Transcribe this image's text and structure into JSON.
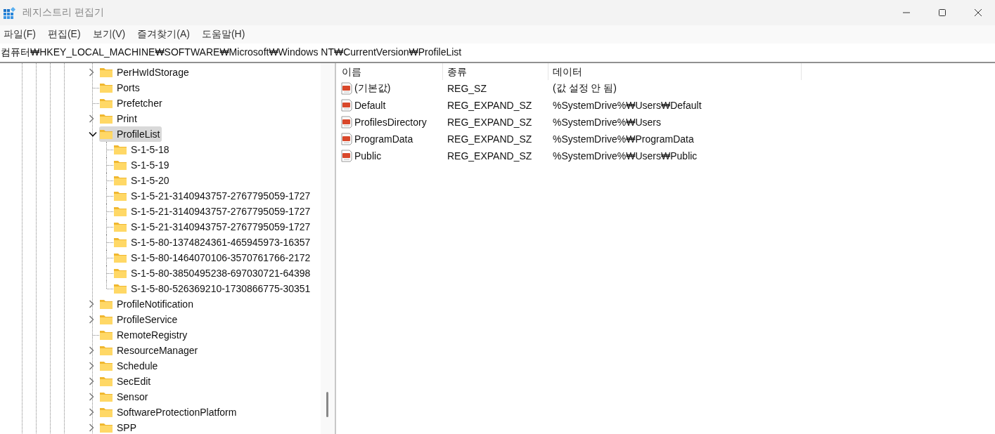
{
  "window": {
    "title": "레지스트리 편집기"
  },
  "menu": [
    "파일(F)",
    "편집(E)",
    "보기(V)",
    "즐겨찾기(A)",
    "도움말(H)"
  ],
  "address": "컴퓨터₩HKEY_LOCAL_MACHINE₩SOFTWARE₩Microsoft₩Windows NT₩CurrentVersion₩ProfileList",
  "tree": {
    "items": [
      {
        "label": "PerHwIdStorage",
        "kind": "branch",
        "expanded": false,
        "selected": false
      },
      {
        "label": "Ports",
        "kind": "leaf",
        "selected": false
      },
      {
        "label": "Prefetcher",
        "kind": "leaf",
        "selected": false
      },
      {
        "label": "Print",
        "kind": "branch",
        "expanded": false,
        "selected": false
      },
      {
        "label": "ProfileList",
        "kind": "branch",
        "expanded": true,
        "selected": true,
        "children": [
          {
            "label": "S-1-5-18",
            "kind": "leaf",
            "selected": false
          },
          {
            "label": "S-1-5-19",
            "kind": "leaf",
            "selected": false
          },
          {
            "label": "S-1-5-20",
            "kind": "leaf",
            "selected": false
          },
          {
            "label": "S-1-5-21-3140943757-2767795059-1727",
            "kind": "leaf",
            "selected": false
          },
          {
            "label": "S-1-5-21-3140943757-2767795059-1727",
            "kind": "leaf",
            "selected": false
          },
          {
            "label": "S-1-5-21-3140943757-2767795059-1727",
            "kind": "leaf",
            "selected": false
          },
          {
            "label": "S-1-5-80-1374824361-465945973-16357",
            "kind": "leaf",
            "selected": false
          },
          {
            "label": "S-1-5-80-1464070106-3570761766-2172",
            "kind": "leaf",
            "selected": false
          },
          {
            "label": "S-1-5-80-3850495238-697030721-64398",
            "kind": "leaf",
            "selected": false
          },
          {
            "label": "S-1-5-80-526369210-1730866775-30351",
            "kind": "leaf",
            "selected": false
          }
        ]
      },
      {
        "label": "ProfileNotification",
        "kind": "branch",
        "expanded": false,
        "selected": false
      },
      {
        "label": "ProfileService",
        "kind": "branch",
        "expanded": false,
        "selected": false
      },
      {
        "label": "RemoteRegistry",
        "kind": "leaf",
        "selected": false
      },
      {
        "label": "ResourceManager",
        "kind": "branch",
        "expanded": false,
        "selected": false
      },
      {
        "label": "Schedule",
        "kind": "branch",
        "expanded": false,
        "selected": false
      },
      {
        "label": "SecEdit",
        "kind": "branch",
        "expanded": false,
        "selected": false
      },
      {
        "label": "Sensor",
        "kind": "branch",
        "expanded": false,
        "selected": false
      },
      {
        "label": "SoftwareProtectionPlatform",
        "kind": "branch",
        "expanded": false,
        "selected": false
      },
      {
        "label": "SPP",
        "kind": "branch",
        "expanded": false,
        "selected": false
      }
    ]
  },
  "values": {
    "columns": [
      "이름",
      "종류",
      "데이터"
    ],
    "rows": [
      {
        "name": "(기본값)",
        "type": "REG_SZ",
        "data": "(값 설정 안 됨)"
      },
      {
        "name": "Default",
        "type": "REG_EXPAND_SZ",
        "data": "%SystemDrive%₩Users₩Default"
      },
      {
        "name": "ProfilesDirectory",
        "type": "REG_EXPAND_SZ",
        "data": "%SystemDrive%₩Users"
      },
      {
        "name": "ProgramData",
        "type": "REG_EXPAND_SZ",
        "data": "%SystemDrive%₩ProgramData"
      },
      {
        "name": "Public",
        "type": "REG_EXPAND_SZ",
        "data": "%SystemDrive%₩Users₩Public"
      }
    ]
  }
}
